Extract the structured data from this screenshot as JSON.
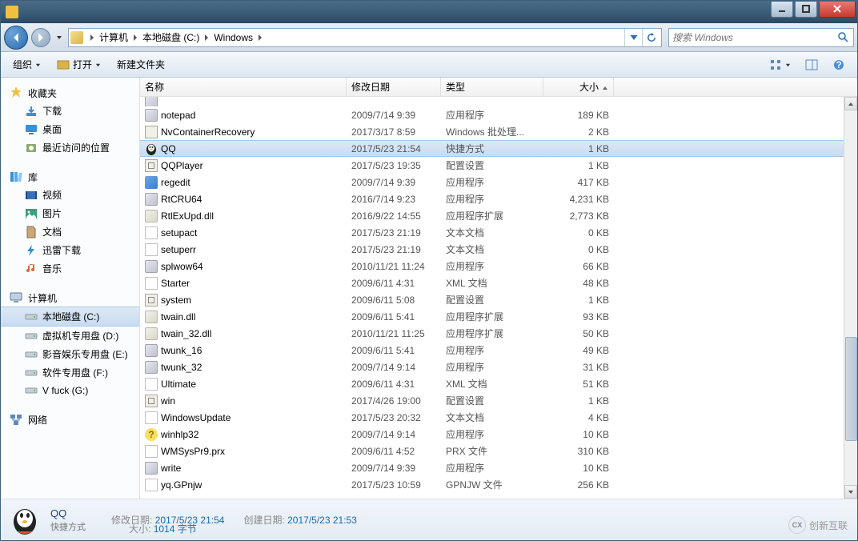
{
  "window": {
    "title": ""
  },
  "nav": {
    "crumbs": [
      "计算机",
      "本地磁盘 (C:)",
      "Windows"
    ],
    "search_placeholder": "搜索 Windows"
  },
  "toolbar": {
    "organize": "组织",
    "open": "打开",
    "new_folder": "新建文件夹"
  },
  "sidebar": {
    "favorites": {
      "label": "收藏夹",
      "items": [
        {
          "label": "下载",
          "icon": "download"
        },
        {
          "label": "桌面",
          "icon": "desktop"
        },
        {
          "label": "最近访问的位置",
          "icon": "recent"
        }
      ]
    },
    "libraries": {
      "label": "库",
      "items": [
        {
          "label": "视频",
          "icon": "video"
        },
        {
          "label": "图片",
          "icon": "picture"
        },
        {
          "label": "文档",
          "icon": "document"
        },
        {
          "label": "迅雷下载",
          "icon": "thunder"
        },
        {
          "label": "音乐",
          "icon": "music"
        }
      ]
    },
    "computer": {
      "label": "计算机",
      "items": [
        {
          "label": "本地磁盘 (C:)",
          "icon": "drive",
          "selected": true
        },
        {
          "label": "虚拟机专用盘 (D:)",
          "icon": "drive"
        },
        {
          "label": "影音娱乐专用盘 (E:)",
          "icon": "drive"
        },
        {
          "label": "软件专用盘 (F:)",
          "icon": "drive"
        },
        {
          "label": "V fuck (G:)",
          "icon": "drive"
        }
      ]
    },
    "network": {
      "label": "网络"
    }
  },
  "columns": {
    "name": "名称",
    "date": "修改日期",
    "type": "类型",
    "size": "大小"
  },
  "files": [
    {
      "name": "notepad",
      "date": "2009/7/14 9:39",
      "type": "应用程序",
      "size": "189 KB",
      "icon": "exe"
    },
    {
      "name": "NvContainerRecovery",
      "date": "2017/3/17 8:59",
      "type": "Windows 批处理...",
      "size": "2 KB",
      "icon": "bat"
    },
    {
      "name": "QQ",
      "date": "2017/5/23 21:54",
      "type": "快捷方式",
      "size": "1 KB",
      "icon": "qq",
      "selected": true
    },
    {
      "name": "QQPlayer",
      "date": "2017/5/23 19:35",
      "type": "配置设置",
      "size": "1 KB",
      "icon": "ini"
    },
    {
      "name": "regedit",
      "date": "2009/7/14 9:39",
      "type": "应用程序",
      "size": "417 KB",
      "icon": "reg"
    },
    {
      "name": "RtCRU64",
      "date": "2016/7/14 9:23",
      "type": "应用程序",
      "size": "4,231 KB",
      "icon": "exe"
    },
    {
      "name": "RtlExUpd.dll",
      "date": "2016/9/22 14:55",
      "type": "应用程序扩展",
      "size": "2,773 KB",
      "icon": "dll"
    },
    {
      "name": "setupact",
      "date": "2017/5/23 21:19",
      "type": "文本文档",
      "size": "0 KB",
      "icon": "txt"
    },
    {
      "name": "setuperr",
      "date": "2017/5/23 21:19",
      "type": "文本文档",
      "size": "0 KB",
      "icon": "txt"
    },
    {
      "name": "splwow64",
      "date": "2010/11/21 11:24",
      "type": "应用程序",
      "size": "66 KB",
      "icon": "exe"
    },
    {
      "name": "Starter",
      "date": "2009/6/11 4:31",
      "type": "XML 文档",
      "size": "48 KB",
      "icon": "xml"
    },
    {
      "name": "system",
      "date": "2009/6/11 5:08",
      "type": "配置设置",
      "size": "1 KB",
      "icon": "ini"
    },
    {
      "name": "twain.dll",
      "date": "2009/6/11 5:41",
      "type": "应用程序扩展",
      "size": "93 KB",
      "icon": "dll"
    },
    {
      "name": "twain_32.dll",
      "date": "2010/11/21 11:25",
      "type": "应用程序扩展",
      "size": "50 KB",
      "icon": "dll"
    },
    {
      "name": "twunk_16",
      "date": "2009/6/11 5:41",
      "type": "应用程序",
      "size": "49 KB",
      "icon": "exe"
    },
    {
      "name": "twunk_32",
      "date": "2009/7/14 9:14",
      "type": "应用程序",
      "size": "31 KB",
      "icon": "exe"
    },
    {
      "name": "Ultimate",
      "date": "2009/6/11 4:31",
      "type": "XML 文档",
      "size": "51 KB",
      "icon": "xml"
    },
    {
      "name": "win",
      "date": "2017/4/26 19:00",
      "type": "配置设置",
      "size": "1 KB",
      "icon": "ini"
    },
    {
      "name": "WindowsUpdate",
      "date": "2017/5/23 20:32",
      "type": "文本文档",
      "size": "4 KB",
      "icon": "txt"
    },
    {
      "name": "winhlp32",
      "date": "2009/7/14 9:14",
      "type": "应用程序",
      "size": "10 KB",
      "icon": "help"
    },
    {
      "name": "WMSysPr9.prx",
      "date": "2009/6/11 4:52",
      "type": "PRX 文件",
      "size": "310 KB",
      "icon": "file"
    },
    {
      "name": "write",
      "date": "2009/7/14 9:39",
      "type": "应用程序",
      "size": "10 KB",
      "icon": "exe"
    },
    {
      "name": "yq.GPnjw",
      "date": "2017/5/23 10:59",
      "type": "GPNJW 文件",
      "size": "256 KB",
      "icon": "file"
    }
  ],
  "details": {
    "name": "QQ",
    "type": "快捷方式",
    "date_modified_label": "修改日期:",
    "date_modified": "2017/5/23 21:54",
    "size_label": "大小:",
    "size": "1014 字节",
    "date_created_label": "创建日期:",
    "date_created": "2017/5/23 21:53"
  },
  "watermark": "创新互联"
}
